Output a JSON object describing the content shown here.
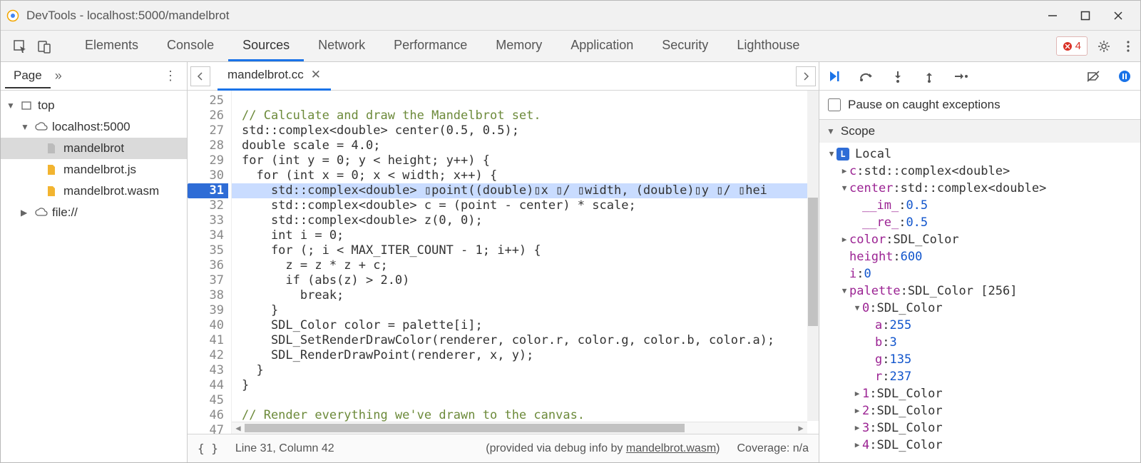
{
  "window": {
    "title": "DevTools - localhost:5000/mandelbrot"
  },
  "tabs": {
    "items": [
      "Elements",
      "Console",
      "Sources",
      "Network",
      "Performance",
      "Memory",
      "Application",
      "Security",
      "Lighthouse"
    ],
    "active_index": 2,
    "error_count": "4"
  },
  "sidebar": {
    "page_label": "Page",
    "tree": {
      "top": "top",
      "host": "localhost:5000",
      "files": [
        "mandelbrot",
        "mandelbrot.js",
        "mandelbrot.wasm"
      ],
      "file_scheme": "file://"
    }
  },
  "editor": {
    "filename": "mandelbrot.cc",
    "first_line_no": 25,
    "current_line_no": 31,
    "lines": [
      {
        "n": 25,
        "t": ""
      },
      {
        "n": 26,
        "t": "// Calculate and draw the Mandelbrot set.",
        "cls": "cmt"
      },
      {
        "n": 27,
        "t": "std::complex<double> center(0.5, 0.5);"
      },
      {
        "n": 28,
        "t": "double scale = 4.0;"
      },
      {
        "n": 29,
        "t": "for (int y = 0; y < height; y++) {"
      },
      {
        "n": 30,
        "t": "  for (int x = 0; x < width; x++) {"
      },
      {
        "n": 31,
        "t": "    std::complex<double> ▯point((double)▯x ▯/ ▯width, (double)▯y ▯/ ▯hei"
      },
      {
        "n": 32,
        "t": "    std::complex<double> c = (point - center) * scale;"
      },
      {
        "n": 33,
        "t": "    std::complex<double> z(0, 0);"
      },
      {
        "n": 34,
        "t": "    int i = 0;"
      },
      {
        "n": 35,
        "t": "    for (; i < MAX_ITER_COUNT - 1; i++) {"
      },
      {
        "n": 36,
        "t": "      z = z * z + c;"
      },
      {
        "n": 37,
        "t": "      if (abs(z) > 2.0)"
      },
      {
        "n": 38,
        "t": "        break;"
      },
      {
        "n": 39,
        "t": "    }"
      },
      {
        "n": 40,
        "t": "    SDL_Color color = palette[i];"
      },
      {
        "n": 41,
        "t": "    SDL_SetRenderDrawColor(renderer, color.r, color.g, color.b, color.a);"
      },
      {
        "n": 42,
        "t": "    SDL_RenderDrawPoint(renderer, x, y);"
      },
      {
        "n": 43,
        "t": "  }"
      },
      {
        "n": 44,
        "t": "}"
      },
      {
        "n": 45,
        "t": ""
      },
      {
        "n": 46,
        "t": "// Render everything we've drawn to the canvas.",
        "cls": "cmt"
      },
      {
        "n": 47,
        "t": ""
      }
    ]
  },
  "status": {
    "pos": "Line 31, Column 42",
    "debug_info_prefix": "(provided via debug info by ",
    "debug_info_link": "mandelbrot.wasm",
    "debug_info_suffix": ")",
    "coverage": "Coverage: n/a"
  },
  "debugger": {
    "pause_on_caught": "Pause on caught exceptions",
    "scope_label": "Scope",
    "local_label": "Local",
    "entries": [
      {
        "indent": 1,
        "tw": "▶",
        "key": "c",
        "sep": ": ",
        "val": "std::complex<double>",
        "vcls": "valtype"
      },
      {
        "indent": 1,
        "tw": "▼",
        "key": "center",
        "sep": ": ",
        "val": "std::complex<double>",
        "vcls": "valtype"
      },
      {
        "indent": 2,
        "tw": "",
        "key": "__im_",
        "sep": ": ",
        "val": "0.5",
        "vcls": "valnum"
      },
      {
        "indent": 2,
        "tw": "",
        "key": "__re_",
        "sep": ": ",
        "val": "0.5",
        "vcls": "valnum"
      },
      {
        "indent": 1,
        "tw": "▶",
        "key": "color",
        "sep": ": ",
        "val": "SDL_Color",
        "vcls": "valtype"
      },
      {
        "indent": 1,
        "tw": "",
        "key": "height",
        "sep": ": ",
        "val": "600",
        "vcls": "valnum"
      },
      {
        "indent": 1,
        "tw": "",
        "key": "i",
        "sep": ": ",
        "val": "0",
        "vcls": "valnum"
      },
      {
        "indent": 1,
        "tw": "▼",
        "key": "palette",
        "sep": ": ",
        "val": "SDL_Color [256]",
        "vcls": "valtype"
      },
      {
        "indent": 2,
        "tw": "▼",
        "key": "0",
        "sep": ": ",
        "val": "SDL_Color",
        "vcls": "valtype"
      },
      {
        "indent": 3,
        "tw": "",
        "key": "a",
        "sep": ": ",
        "val": "255",
        "vcls": "valnum"
      },
      {
        "indent": 3,
        "tw": "",
        "key": "b",
        "sep": ": ",
        "val": "3",
        "vcls": "valnum"
      },
      {
        "indent": 3,
        "tw": "",
        "key": "g",
        "sep": ": ",
        "val": "135",
        "vcls": "valnum"
      },
      {
        "indent": 3,
        "tw": "",
        "key": "r",
        "sep": ": ",
        "val": "237",
        "vcls": "valnum"
      },
      {
        "indent": 2,
        "tw": "▶",
        "key": "1",
        "sep": ": ",
        "val": "SDL_Color",
        "vcls": "valtype"
      },
      {
        "indent": 2,
        "tw": "▶",
        "key": "2",
        "sep": ": ",
        "val": "SDL_Color",
        "vcls": "valtype"
      },
      {
        "indent": 2,
        "tw": "▶",
        "key": "3",
        "sep": ": ",
        "val": "SDL_Color",
        "vcls": "valtype"
      },
      {
        "indent": 2,
        "tw": "▶",
        "key": "4",
        "sep": ": ",
        "val": "SDL_Color",
        "vcls": "valtype"
      }
    ]
  }
}
